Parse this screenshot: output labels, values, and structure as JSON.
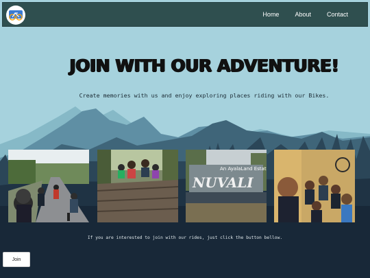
{
  "nav": {
    "links": [
      "Home",
      "About",
      "Contact"
    ]
  },
  "hero": {
    "title": "JOIN WITH OUR ADVENTURE!",
    "subtitle": "Create memories with us and enjoy exploring places riding with our Bikes."
  },
  "gallery": {
    "photos": [
      "road-cyclists-photo",
      "group-rest-photo",
      "nuvali-sign-photo",
      "group-selfie-photo"
    ],
    "nuvali_caption": "An AyalaLand Estate",
    "nuvali_sign": "NUVALI"
  },
  "footer": {
    "cta_text": "If you are interested to join with our rides, just click the button bellow.",
    "join_label": "Join"
  },
  "colors": {
    "sky": "#a6d2dd",
    "navbar": "#2f4f4f",
    "dark_ground": "#182838"
  }
}
